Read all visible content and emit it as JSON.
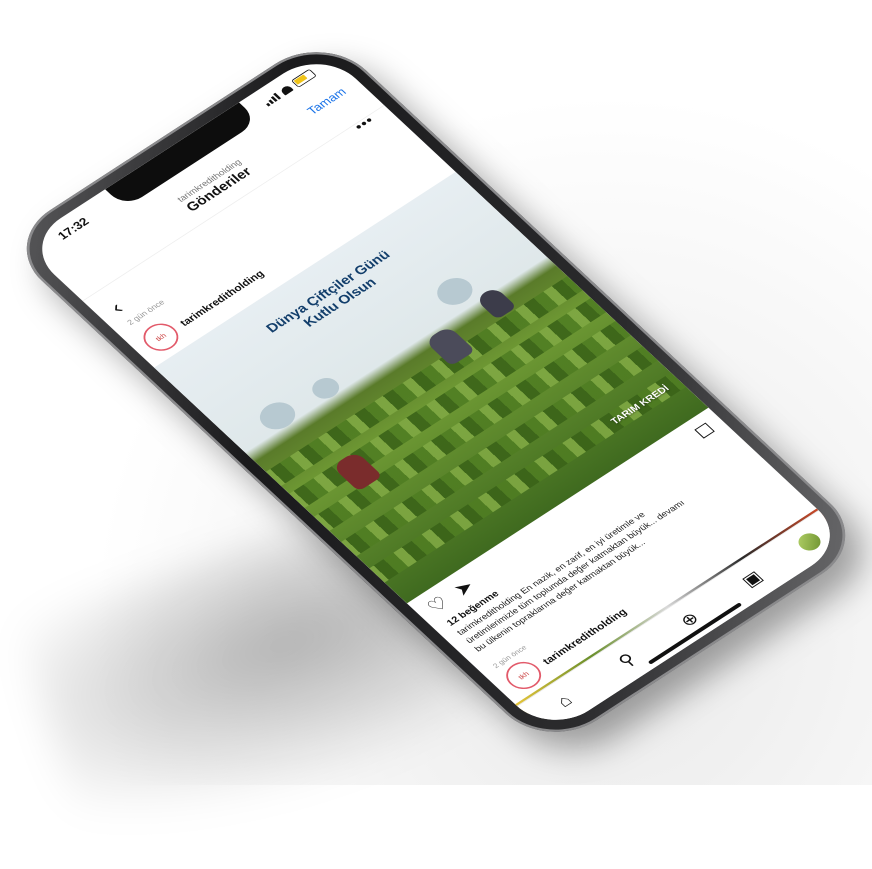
{
  "status": {
    "time": "17:32"
  },
  "header": {
    "account": "tarimkreditholding",
    "title": "Gönderiler",
    "done_label": "Tamam"
  },
  "post": {
    "date_label": "2 gün önce",
    "username": "tarimkreditholding",
    "avatar_text": "tkh",
    "media": {
      "title_line1": "Dünya Çiftçiler Günü",
      "title_line2": "Kutlu Olsun",
      "watermark": "TARIM KREDİ"
    },
    "likes": "12 beğenme",
    "caption_line1": "tarimkreditholding En nazik, en zarif, en iyi üretimle ve",
    "caption_line2": "üretimlerimizle tüm toplumda değer katmaktan büyük... devamı",
    "caption_line3": "bu ülkenin topraklarına değer katmaktan büyük..."
  },
  "next_post": {
    "date_label": "2 gün önce",
    "username": "tarimkreditholding",
    "avatar_text": "tkh"
  },
  "icons": [
    "back-arrow-icon",
    "heart-icon",
    "send-icon",
    "bookmark-icon",
    "home-icon",
    "search-icon",
    "add-icon",
    "reels-icon",
    "profile-avatar-icon",
    "more-options-icon"
  ],
  "colors": {
    "link": "#1a73e8",
    "avatar_ring": "#e25a6a",
    "sky_title": "#123e6b"
  }
}
